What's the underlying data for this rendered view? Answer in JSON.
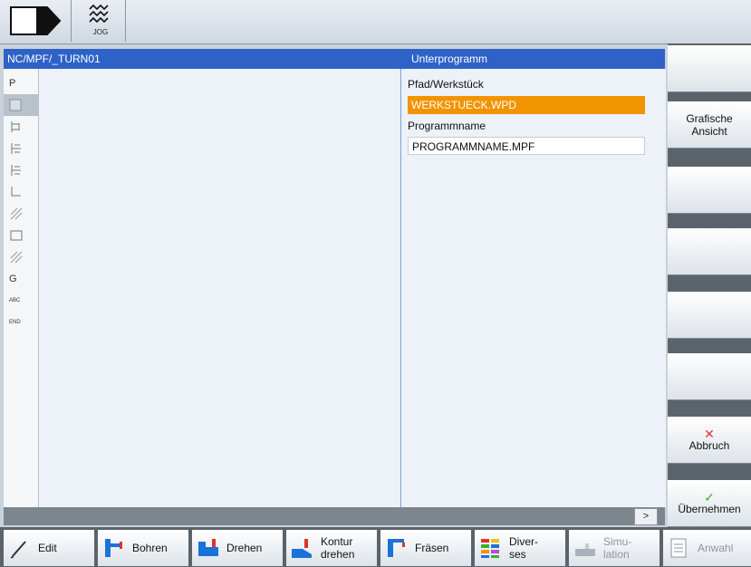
{
  "mode": {
    "jog_label": "JOG"
  },
  "header": {
    "path": "NC/MPF/_TURN01",
    "dialog_title": "Unterprogramm"
  },
  "gutter": [
    "P",
    "",
    "",
    "",
    "",
    "",
    "",
    "",
    "",
    "G",
    "ABC",
    "END"
  ],
  "form": {
    "path_label": "Pfad/Werkstück",
    "path_value": "WERKSTUECK.WPD",
    "name_label": "Programmname",
    "name_value": "PROGRAMMNAME.MPF"
  },
  "statusbar": {
    "more_label": ">"
  },
  "vertical_softkeys": {
    "grafische_1": "Grafische",
    "grafische_2": "Ansicht",
    "abbruch": "Abbruch",
    "uebernehmen": "Übernehmen"
  },
  "horizontal_softkeys": {
    "edit": "Edit",
    "bohren": "Bohren",
    "drehen": "Drehen",
    "kontur_1": "Kontur",
    "kontur_2": "drehen",
    "fraesen": "Fräsen",
    "diverses_1": "Diver-",
    "diverses_2": "ses",
    "simulation_1": "Simu-",
    "simulation_2": "lation",
    "anwahl": "Anwahl"
  },
  "colors": {
    "header_blue": "#2e62c8",
    "highlight_orange": "#f29400",
    "cancel_red": "#e0312b",
    "accept_green": "#3cae2e"
  }
}
